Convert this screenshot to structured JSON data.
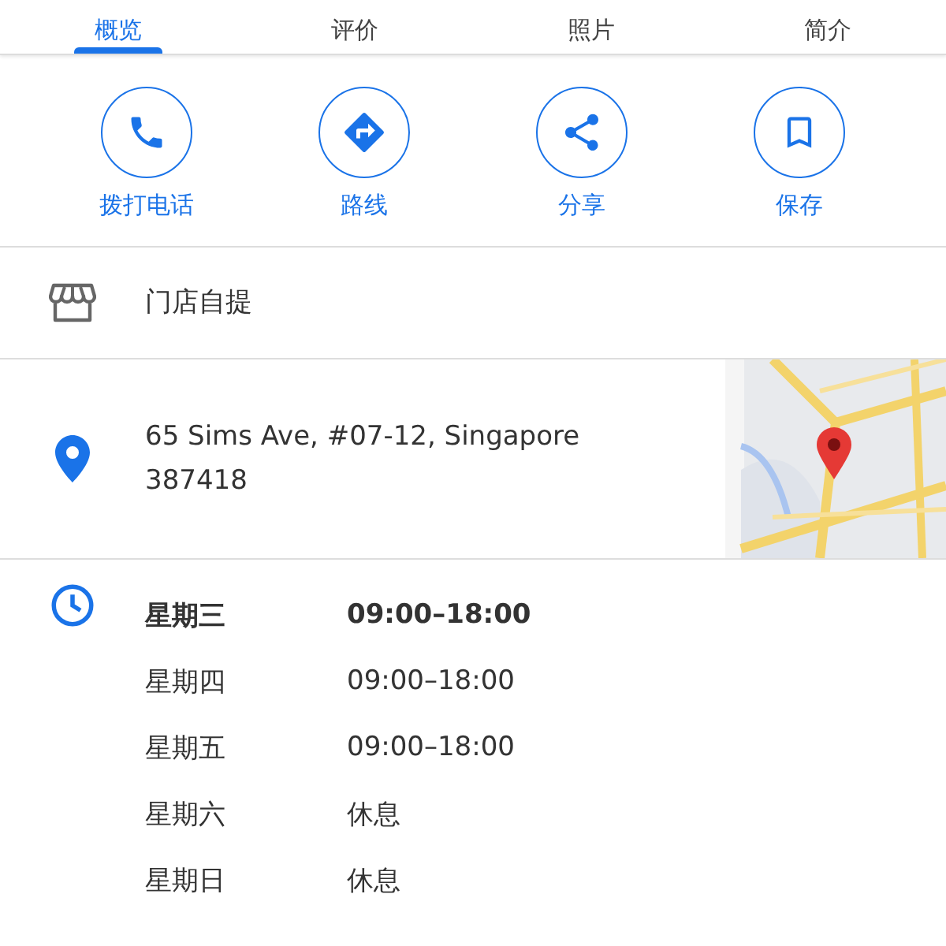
{
  "tabs": [
    {
      "label": "概览",
      "selected": true
    },
    {
      "label": "评价",
      "selected": false
    },
    {
      "label": "照片",
      "selected": false
    },
    {
      "label": "简介",
      "selected": false
    }
  ],
  "actions": [
    {
      "kind": "call",
      "label": "拨打电话"
    },
    {
      "kind": "directions",
      "label": "路线"
    },
    {
      "kind": "share",
      "label": "分享"
    },
    {
      "kind": "save",
      "label": "保存"
    }
  ],
  "pickup": {
    "label": "门店自提"
  },
  "address": {
    "line_1": "65 Sims Ave, #07-12, Singapore",
    "line_2": "387418"
  },
  "hours": [
    {
      "day": "星期三",
      "time": "09:00–18:00",
      "selected": true
    },
    {
      "day": "星期四",
      "time": "09:00–18:00",
      "selected": false
    },
    {
      "day": "星期五",
      "time": "09:00–18:00",
      "selected": false
    },
    {
      "day": "星期六",
      "time": "休息",
      "selected": false
    },
    {
      "day": "星期日",
      "time": "休息",
      "selected": false
    }
  ]
}
